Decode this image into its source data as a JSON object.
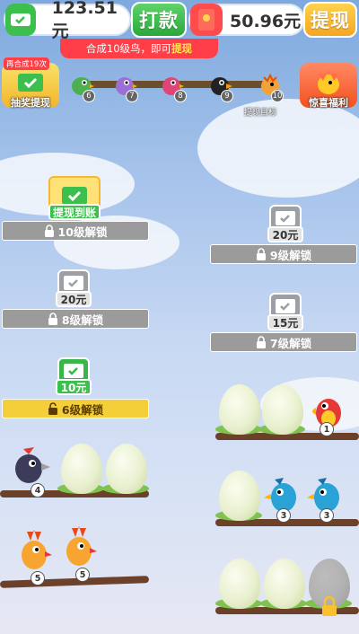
{
  "top_bar": {
    "balance_amount": "123.51元",
    "withdraw_cash_button": "打款",
    "redpacket_amount": "50.96元",
    "withdraw_button": "提现",
    "hint_prefix": "合成10级鸟，即可",
    "hint_highlight": "提现"
  },
  "progress": {
    "lottery_badge": "再合成19次",
    "lottery_label": "抽奖提现",
    "levels": [
      "6",
      "7",
      "8",
      "9",
      "10"
    ],
    "goal_label": "提现目标",
    "bonus_label": "惊喜福利"
  },
  "rewards": [
    {
      "amount": "提现到账",
      "unlock": "10级解锁",
      "state": "ready"
    },
    {
      "amount": "20元",
      "unlock": "9级解锁",
      "state": "locked"
    },
    {
      "amount": "20元",
      "unlock": "8级解锁",
      "state": "locked"
    },
    {
      "amount": "15元",
      "unlock": "7级解锁",
      "state": "locked"
    },
    {
      "amount": "10元",
      "unlock": "6级解锁",
      "state": "active"
    }
  ],
  "birds": {
    "b1": "1",
    "b2": "4",
    "b3": "3",
    "b4": "3",
    "b5": "5",
    "b6": "5"
  },
  "colors": {
    "green": "#3dbf4e",
    "red": "#ff3e47",
    "orange": "#f39c12",
    "gold": "#f5cf3a"
  }
}
